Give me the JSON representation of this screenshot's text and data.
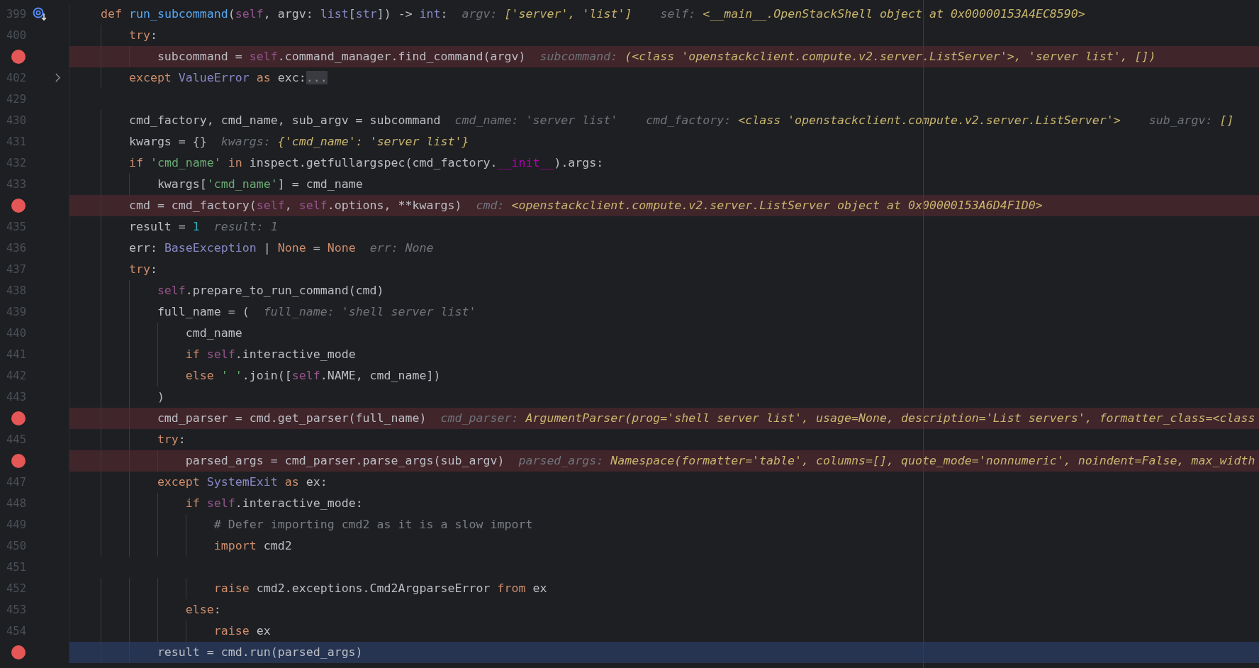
{
  "editor": {
    "lines": [
      {
        "number": "399",
        "breakpoint": false,
        "current": false,
        "folded": false,
        "execution_marker": true,
        "tokens": [
          {
            "kind": "keyword",
            "text": "    def "
          },
          {
            "kind": "function",
            "text": "run_subcommand"
          },
          {
            "kind": "plain",
            "text": "("
          },
          {
            "kind": "self",
            "text": "self"
          },
          {
            "kind": "plain",
            "text": ", argv: "
          },
          {
            "kind": "type",
            "text": "list"
          },
          {
            "kind": "plain",
            "text": "["
          },
          {
            "kind": "type",
            "text": "str"
          },
          {
            "kind": "plain",
            "text": "]) -> "
          },
          {
            "kind": "type",
            "text": "int"
          },
          {
            "kind": "plain",
            "text": ":"
          }
        ],
        "hints": [
          {
            "name": "argv:",
            "value": "['server', 'list']",
            "changed": true
          },
          {
            "name": "self:",
            "value": "<__main__.OpenStackShell object at 0x00000153A4EC8590>",
            "changed": true
          }
        ]
      },
      {
        "number": "400",
        "breakpoint": false,
        "current": false,
        "folded": false,
        "execution_marker": false,
        "tokens": [
          {
            "kind": "keyword",
            "text": "        try"
          },
          {
            "kind": "plain",
            "text": ":"
          }
        ]
      },
      {
        "breakpoint": true,
        "current": false,
        "folded": false,
        "execution_marker": false,
        "tokens": [
          {
            "kind": "plain",
            "text": "            subcommand = "
          },
          {
            "kind": "self",
            "text": "self"
          },
          {
            "kind": "plain",
            "text": ".command_manager.find_command(argv)"
          }
        ],
        "hints": [
          {
            "name": "subcommand:",
            "value": "(<class 'openstackclient.compute.v2.server.ListServer'>, 'server list', [])",
            "changed": true
          }
        ]
      },
      {
        "number": "402",
        "breakpoint": false,
        "current": false,
        "folded": true,
        "execution_marker": false,
        "tokens": [
          {
            "kind": "keyword",
            "text": "        except "
          },
          {
            "kind": "type",
            "text": "ValueError"
          },
          {
            "kind": "keyword",
            "text": " as"
          },
          {
            "kind": "plain",
            "text": " exc:"
          },
          {
            "kind": "fold",
            "text": "..."
          }
        ]
      },
      {
        "number": "429",
        "breakpoint": false,
        "current": false,
        "folded": false,
        "execution_marker": false
      },
      {
        "number": "430",
        "breakpoint": false,
        "current": false,
        "folded": false,
        "execution_marker": false,
        "tokens": [
          {
            "kind": "plain",
            "text": "        cmd_factory, cmd_name, sub_argv = subcommand"
          }
        ],
        "hints": [
          {
            "name": "cmd_name:",
            "value": "'server list'",
            "changed": false
          },
          {
            "name": "cmd_factory:",
            "value": "<class 'openstackclient.compute.v2.server.ListServer'>",
            "changed": true
          },
          {
            "name": "sub_argv:",
            "value": "[]",
            "changed": true
          }
        ]
      },
      {
        "number": "431",
        "breakpoint": false,
        "current": false,
        "folded": false,
        "execution_marker": false,
        "tokens": [
          {
            "kind": "plain",
            "text": "        kwargs = {}"
          }
        ],
        "hints": [
          {
            "name": "kwargs:",
            "value": "{'cmd_name': 'server list'}",
            "changed": true
          }
        ]
      },
      {
        "number": "432",
        "breakpoint": false,
        "current": false,
        "folded": false,
        "execution_marker": false,
        "tokens": [
          {
            "kind": "keyword",
            "text": "        if "
          },
          {
            "kind": "string",
            "text": "'cmd_name'"
          },
          {
            "kind": "keyword",
            "text": " in"
          },
          {
            "kind": "plain",
            "text": " inspect.getfullargspec(cmd_factory."
          },
          {
            "kind": "dunder",
            "text": "__init__"
          },
          {
            "kind": "plain",
            "text": ").args:"
          }
        ]
      },
      {
        "number": "433",
        "breakpoint": false,
        "current": false,
        "folded": false,
        "execution_marker": false,
        "tokens": [
          {
            "kind": "plain",
            "text": "            kwargs["
          },
          {
            "kind": "string",
            "text": "'cmd_name'"
          },
          {
            "kind": "plain",
            "text": "] = cmd_name"
          }
        ]
      },
      {
        "breakpoint": true,
        "current": false,
        "folded": false,
        "execution_marker": false,
        "tokens": [
          {
            "kind": "plain",
            "text": "        cmd = cmd_factory("
          },
          {
            "kind": "self",
            "text": "self"
          },
          {
            "kind": "plain",
            "text": ", "
          },
          {
            "kind": "self",
            "text": "self"
          },
          {
            "kind": "plain",
            "text": ".options, **kwargs)"
          }
        ],
        "hints": [
          {
            "name": "cmd:",
            "value": "<openstackclient.compute.v2.server.ListServer object at 0x00000153A6D4F1D0>",
            "changed": true
          }
        ]
      },
      {
        "number": "435",
        "breakpoint": false,
        "current": false,
        "folded": false,
        "execution_marker": false,
        "tokens": [
          {
            "kind": "plain",
            "text": "        result = "
          },
          {
            "kind": "number",
            "text": "1"
          }
        ],
        "hints": [
          {
            "name": "result:",
            "value": "1",
            "changed": false
          }
        ]
      },
      {
        "number": "436",
        "breakpoint": false,
        "current": false,
        "folded": false,
        "execution_marker": false,
        "tokens": [
          {
            "kind": "plain",
            "text": "        err: "
          },
          {
            "kind": "type",
            "text": "BaseException"
          },
          {
            "kind": "plain",
            "text": " | "
          },
          {
            "kind": "keyword",
            "text": "None"
          },
          {
            "kind": "plain",
            "text": " = "
          },
          {
            "kind": "keyword",
            "text": "None"
          }
        ],
        "hints": [
          {
            "name": "err:",
            "value": "None",
            "changed": false
          }
        ]
      },
      {
        "number": "437",
        "breakpoint": false,
        "current": false,
        "folded": false,
        "execution_marker": false,
        "tokens": [
          {
            "kind": "keyword",
            "text": "        try"
          },
          {
            "kind": "plain",
            "text": ":"
          }
        ]
      },
      {
        "number": "438",
        "breakpoint": false,
        "current": false,
        "folded": false,
        "execution_marker": false,
        "tokens": [
          {
            "kind": "self",
            "text": "            self"
          },
          {
            "kind": "plain",
            "text": ".prepare_to_run_command(cmd)"
          }
        ]
      },
      {
        "number": "439",
        "breakpoint": false,
        "current": false,
        "folded": false,
        "execution_marker": false,
        "tokens": [
          {
            "kind": "plain",
            "text": "            full_name = ("
          }
        ],
        "hints": [
          {
            "name": "full_name:",
            "value": "'shell server list'",
            "changed": false
          }
        ]
      },
      {
        "number": "440",
        "breakpoint": false,
        "current": false,
        "folded": false,
        "execution_marker": false,
        "tokens": [
          {
            "kind": "plain",
            "text": "                cmd_name"
          }
        ]
      },
      {
        "number": "441",
        "breakpoint": false,
        "current": false,
        "folded": false,
        "execution_marker": false,
        "tokens": [
          {
            "kind": "keyword",
            "text": "                if "
          },
          {
            "kind": "self",
            "text": "self"
          },
          {
            "kind": "plain",
            "text": ".interactive_mode"
          }
        ]
      },
      {
        "number": "442",
        "breakpoint": false,
        "current": false,
        "folded": false,
        "execution_marker": false,
        "tokens": [
          {
            "kind": "keyword",
            "text": "                else "
          },
          {
            "kind": "string",
            "text": "' '"
          },
          {
            "kind": "plain",
            "text": ".join(["
          },
          {
            "kind": "self",
            "text": "self"
          },
          {
            "kind": "plain",
            "text": ".NAME, cmd_name])"
          }
        ]
      },
      {
        "number": "443",
        "breakpoint": false,
        "current": false,
        "folded": false,
        "execution_marker": false,
        "tokens": [
          {
            "kind": "plain",
            "text": "            )"
          }
        ]
      },
      {
        "breakpoint": true,
        "current": false,
        "folded": false,
        "execution_marker": false,
        "tokens": [
          {
            "kind": "plain",
            "text": "            cmd_parser = cmd.get_parser(full_name)"
          }
        ],
        "hints": [
          {
            "name": "cmd_parser:",
            "value": "ArgumentParser(prog='shell server list', usage=None, description='List servers', formatter_class=<class",
            "changed": true
          }
        ]
      },
      {
        "number": "445",
        "breakpoint": false,
        "current": false,
        "folded": false,
        "execution_marker": false,
        "tokens": [
          {
            "kind": "keyword",
            "text": "            try"
          },
          {
            "kind": "plain",
            "text": ":"
          }
        ]
      },
      {
        "breakpoint": true,
        "current": false,
        "folded": false,
        "execution_marker": false,
        "tokens": [
          {
            "kind": "plain",
            "text": "                parsed_args = cmd_parser.parse_args(sub_argv)"
          }
        ],
        "hints": [
          {
            "name": "parsed_args:",
            "value": "Namespace(formatter='table', columns=[], quote_mode='nonnumeric', noindent=False, max_width",
            "changed": true
          }
        ]
      },
      {
        "number": "447",
        "breakpoint": false,
        "current": false,
        "folded": false,
        "execution_marker": false,
        "tokens": [
          {
            "kind": "keyword",
            "text": "            except "
          },
          {
            "kind": "type",
            "text": "SystemExit"
          },
          {
            "kind": "keyword",
            "text": " as"
          },
          {
            "kind": "plain",
            "text": " ex:"
          }
        ]
      },
      {
        "number": "448",
        "breakpoint": false,
        "current": false,
        "folded": false,
        "execution_marker": false,
        "tokens": [
          {
            "kind": "keyword",
            "text": "                if "
          },
          {
            "kind": "self",
            "text": "self"
          },
          {
            "kind": "plain",
            "text": ".interactive_mode:"
          }
        ]
      },
      {
        "number": "449",
        "breakpoint": false,
        "current": false,
        "folded": false,
        "execution_marker": false,
        "tokens": [
          {
            "kind": "comment",
            "text": "                    # Defer importing cmd2 as it is a slow import"
          }
        ]
      },
      {
        "number": "450",
        "breakpoint": false,
        "current": false,
        "folded": false,
        "execution_marker": false,
        "tokens": [
          {
            "kind": "keyword",
            "text": "                    import"
          },
          {
            "kind": "plain",
            "text": " cmd2"
          }
        ]
      },
      {
        "number": "451",
        "breakpoint": false,
        "current": false,
        "folded": false,
        "execution_marker": false
      },
      {
        "number": "452",
        "breakpoint": false,
        "current": false,
        "folded": false,
        "execution_marker": false,
        "tokens": [
          {
            "kind": "keyword",
            "text": "                    raise"
          },
          {
            "kind": "plain",
            "text": " cmd2.exceptions.Cmd2ArgparseError "
          },
          {
            "kind": "keyword",
            "text": "from"
          },
          {
            "kind": "plain",
            "text": " ex"
          }
        ]
      },
      {
        "number": "453",
        "breakpoint": false,
        "current": false,
        "folded": false,
        "execution_marker": false,
        "tokens": [
          {
            "kind": "keyword",
            "text": "                else"
          },
          {
            "kind": "plain",
            "text": ":"
          }
        ]
      },
      {
        "number": "454",
        "breakpoint": false,
        "current": false,
        "folded": false,
        "execution_marker": false,
        "tokens": [
          {
            "kind": "keyword",
            "text": "                    raise"
          },
          {
            "kind": "plain",
            "text": " ex"
          }
        ]
      },
      {
        "breakpoint": true,
        "current": true,
        "folded": false,
        "execution_marker": false,
        "tokens": [
          {
            "kind": "plain",
            "text": "            result = cmd.run(parsed_args)"
          }
        ]
      }
    ]
  }
}
